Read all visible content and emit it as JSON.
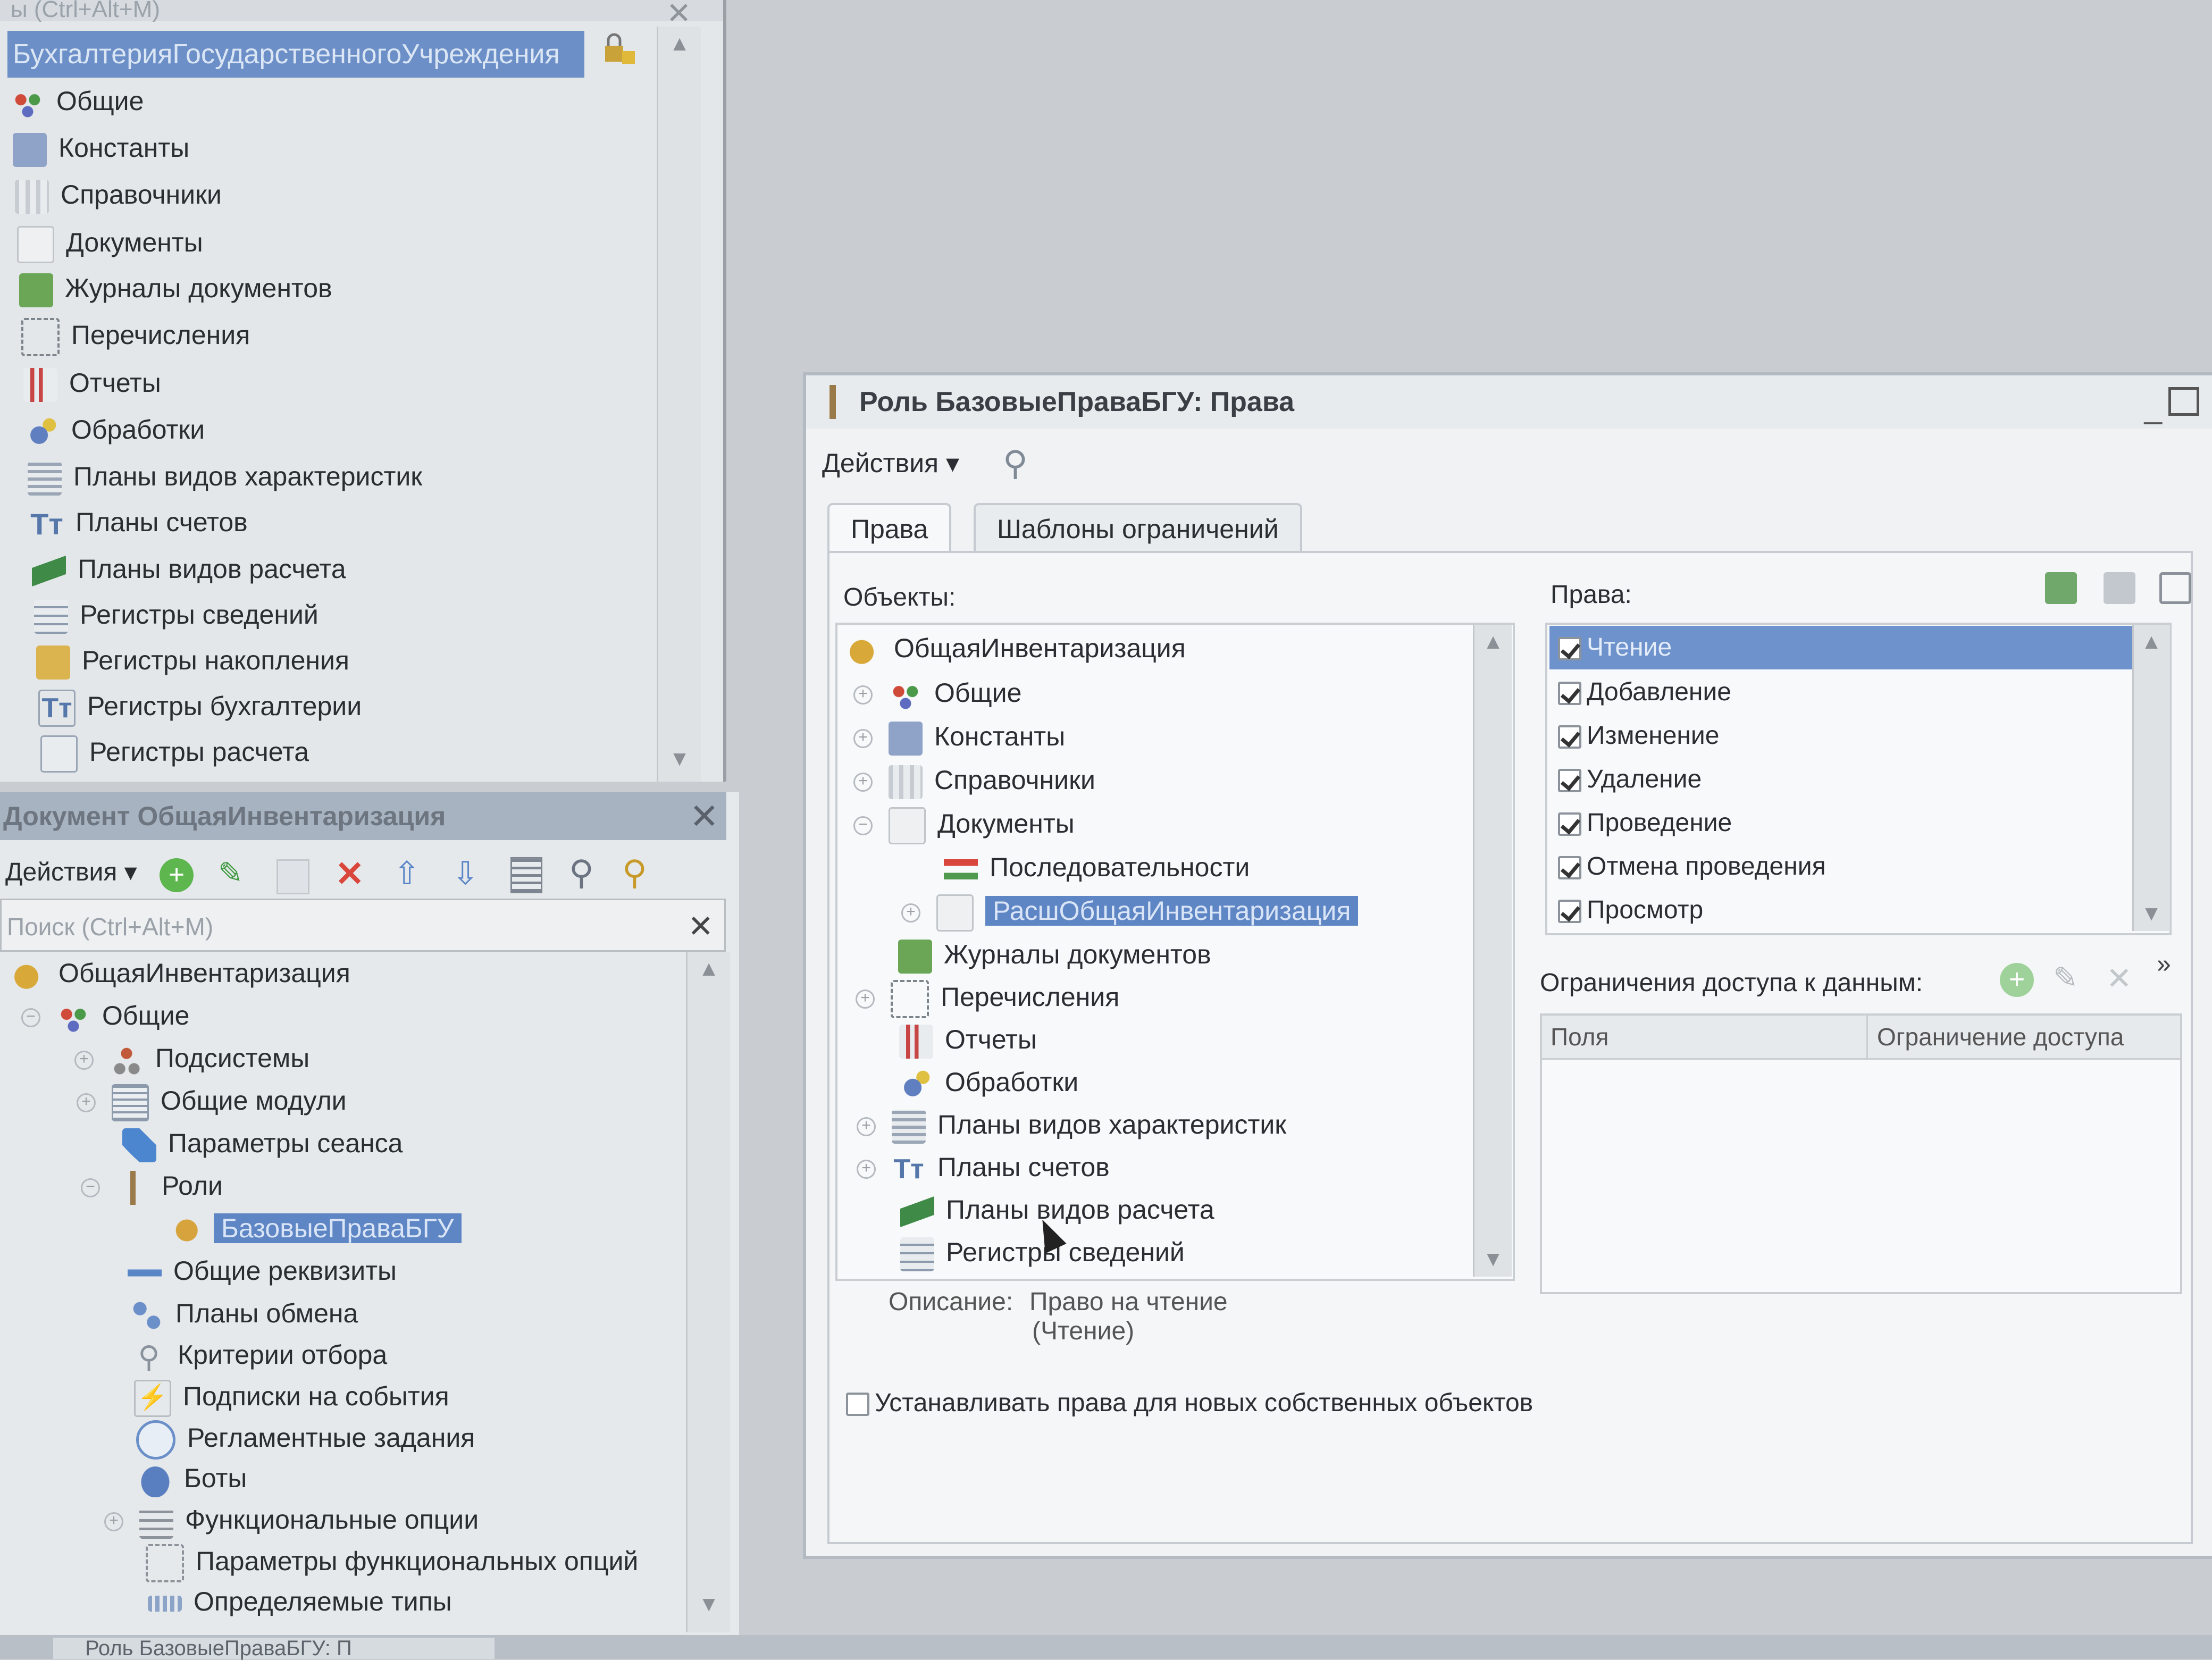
{
  "config_tree": {
    "top_strip_label": "ы (Ctrl+Alt+M)",
    "root": "БухгалтерияГосударственногоУчреждения",
    "items": [
      "Общие",
      "Константы",
      "Справочники",
      "Документы",
      "Журналы документов",
      "Перечисления",
      "Отчеты",
      "Обработки",
      "Планы видов характеристик",
      "Планы счетов",
      "Планы видов расчета",
      "Регистры сведений",
      "Регистры накопления",
      "Регистры бухгалтерии",
      "Регистры расчета"
    ]
  },
  "doc_panel": {
    "title": "Документ ОбщаяИнвентаризация",
    "actions_label": "Действия",
    "search_placeholder": "Поиск (Ctrl+Alt+M)",
    "tree": [
      "ОбщаяИнвентаризация",
      "Общие",
      "Подсистемы",
      "Общие модули",
      "Параметры сеанса",
      "Роли",
      "БазовыеПраваБГУ",
      "Общие реквизиты",
      "Планы обмена",
      "Критерии отбора",
      "Подписки на события",
      "Регламентные задания",
      "Боты",
      "Функциональные опции",
      "Параметры функциональных опций",
      "Определяемые типы"
    ]
  },
  "window": {
    "title": "Роль БазовыеПраваБГУ: Права",
    "actions_label": "Действия",
    "tabs": [
      "Права",
      "Шаблоны ограничений"
    ],
    "objects_label": "Объекты:",
    "rights_label": "Права:",
    "objects": [
      "ОбщаяИнвентаризация",
      "Общие",
      "Константы",
      "Справочники",
      "Документы",
      "Последовательности",
      "РасшОбщаяИнвентаризация",
      "Журналы документов",
      "Перечисления",
      "Отчеты",
      "Обработки",
      "Планы видов характеристик",
      "Планы счетов",
      "Планы видов расчета",
      "Регистры сведений"
    ],
    "rights": [
      "Чтение",
      "Добавление",
      "Изменение",
      "Удаление",
      "Проведение",
      "Отмена проведения",
      "Просмотр"
    ],
    "restrictions_label": "Ограничения доступа к данным:",
    "grid_columns": [
      "Поля",
      "Ограничение доступа"
    ],
    "description_label": "Описание:",
    "description_text": "Право на чтение",
    "description_sub": "(Чтение)",
    "new_objects_checkbox": "Устанавливать права для новых собственных объектов"
  },
  "bottom_tab": "Роль БазовыеПраваБГУ: П",
  "colors": {
    "selection": "#6c8fc8",
    "accent_green": "#58b04a",
    "delete_red": "#d9463c"
  }
}
